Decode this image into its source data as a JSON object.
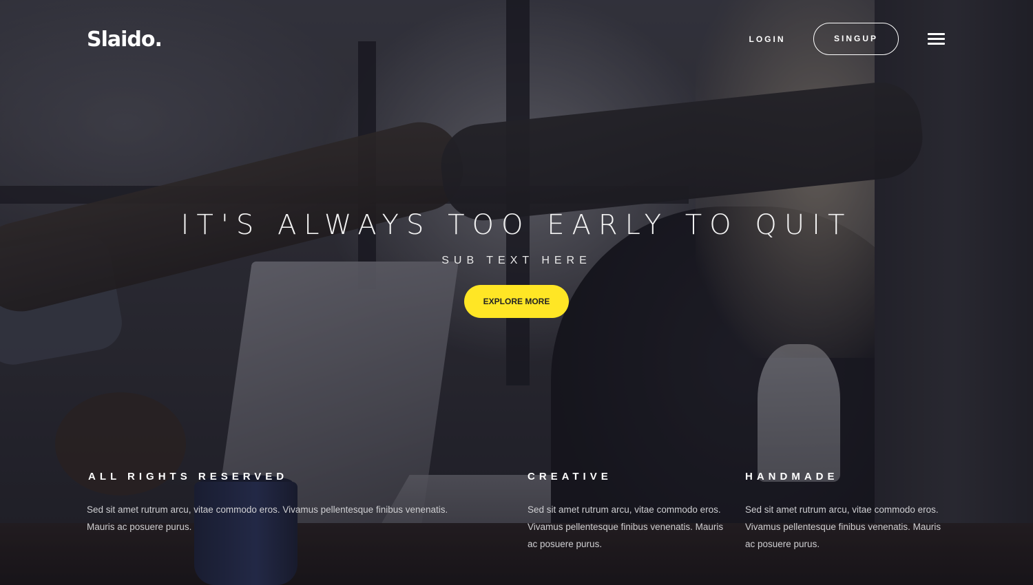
{
  "brand": {
    "logo": "Slaido."
  },
  "nav": {
    "login_label": "LOGIN",
    "signup_label": "SINGUP",
    "menu_icon": "hamburger-menu-icon"
  },
  "hero": {
    "headline": "IT'S ALWAYS TOO EARLY TO QUIT",
    "subtext": "SUB TEXT HERE",
    "cta_label": "EXPLORE MORE",
    "cta_color": "#ffe625"
  },
  "features": [
    {
      "title": "ALL RIGHTS RESERVED",
      "text": "Sed sit amet rutrum arcu, vitae commodo eros. Vivamus pellentesque finibus venenatis. Mauris ac posuere purus."
    },
    {
      "title": "CREATIVE",
      "text": "Sed sit amet rutrum arcu, vitae commodo eros. Vivamus pellentesque finibus venenatis. Mauris ac posuere purus."
    },
    {
      "title": "HANDMADE",
      "text": "Sed sit amet rutrum arcu, vitae commodo eros. Vivamus pellentesque finibus venenatis. Mauris ac posuere purus."
    }
  ]
}
